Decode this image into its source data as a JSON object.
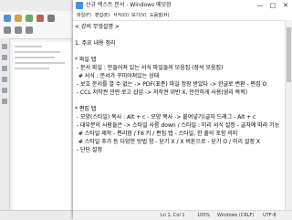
{
  "window": {
    "title": "신규 텍스트 문서 - Windows 메모장",
    "minimize": "—",
    "maximize": "□",
    "close": "✕"
  },
  "menu": [
    "파일(F)",
    "편집(E)",
    "서식(O)",
    "보기(V)",
    "도움말(H)"
  ],
  "editor": {
    "lines": [
      "< 강의 무엇설명 >",
      "",
      "1. 주요 내용 정리",
      "",
      "* 파일 탭",
      " - 문서 파일 : 만들어져 있는 서식 파일들의 모음집 (장석 모음집)",
      "  # 서식 : 문서가 꾸미어져있는 상태",
      " - 보호 문서를 열 수 없는 -> PDF(표준) 파일 정장 받았다 -> 한글로 변환 - 편집 O",
      " - CCL 저작권 관련 로고 삽입 -> 저작권 위반 X, 안전하게 사용(영리 목적)",
      "",
      "* 편집 탭",
      " - 모양(스타일) 복사 : Alt + c - 모양 복사 -> 붙여넣기(글자 드래그 - Alt + c",
      " - 대부분의 사람들은 -> 스타일 사름 down / 스타일 : 미리 서식 설정 - 글자에 따라 기능",
      "  # 스타일 제작 - 편리함 / F6 키 / 편집 탭 - 스타일, 한 줄의 포함 의미",
      "  # 스타일 추가 등 다양한 방법 함 - 닫기 X / X 버튼으로 - 닫기 O / 미리 설정 X",
      " - 단단 설정"
    ]
  },
  "status": {
    "position": "Ln 1, Col 1",
    "zoom": "100%",
    "eol": "Windows (CRLF)",
    "encoding": "UTF-8"
  }
}
